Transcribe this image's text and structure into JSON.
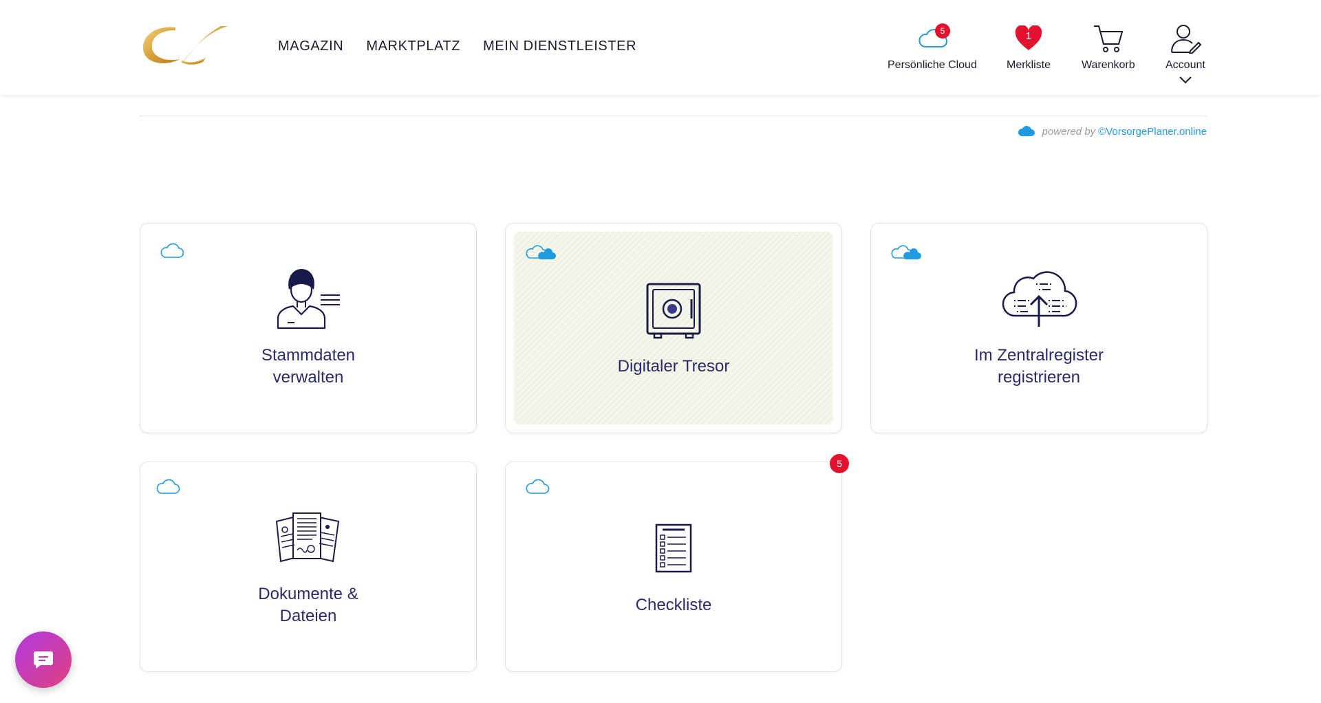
{
  "nav": {
    "items": [
      "MAGAZIN",
      "MARKTPLATZ",
      "MEIN DIENSTLEISTER"
    ]
  },
  "header_icons": {
    "cloud": {
      "label": "Persönliche Cloud",
      "badge": "5",
      "icon": "cloud-icon"
    },
    "wishlist": {
      "label": "Merkliste",
      "badge": "1",
      "icon": "heart-icon"
    },
    "cart": {
      "label": "Warenkorb",
      "icon": "cart-icon"
    },
    "account": {
      "label": "Account",
      "icon": "user-edit-icon"
    }
  },
  "powered": {
    "prefix": "powered by",
    "link": "©VorsorgePlaner.online"
  },
  "cards": [
    {
      "title_line1": "Stammdaten",
      "title_line2": "verwalten",
      "icon": "person-profile-icon"
    },
    {
      "title": "Digitaler Tresor",
      "icon": "safe-icon"
    },
    {
      "title_line1": "Im Zentralregister",
      "title_line2": "registrieren",
      "icon": "cloud-upload-icon"
    },
    {
      "title_line1": "Dokumente &",
      "title_line2": "Dateien",
      "icon": "documents-icon"
    },
    {
      "title": "Checkliste",
      "icon": "checklist-icon",
      "badge": "5"
    }
  ],
  "colors": {
    "accent_blue": "#1e9be0",
    "badge_red": "#e3122e",
    "title_navy": "#2a2a6a",
    "logo_gold": "#d9a23a"
  }
}
